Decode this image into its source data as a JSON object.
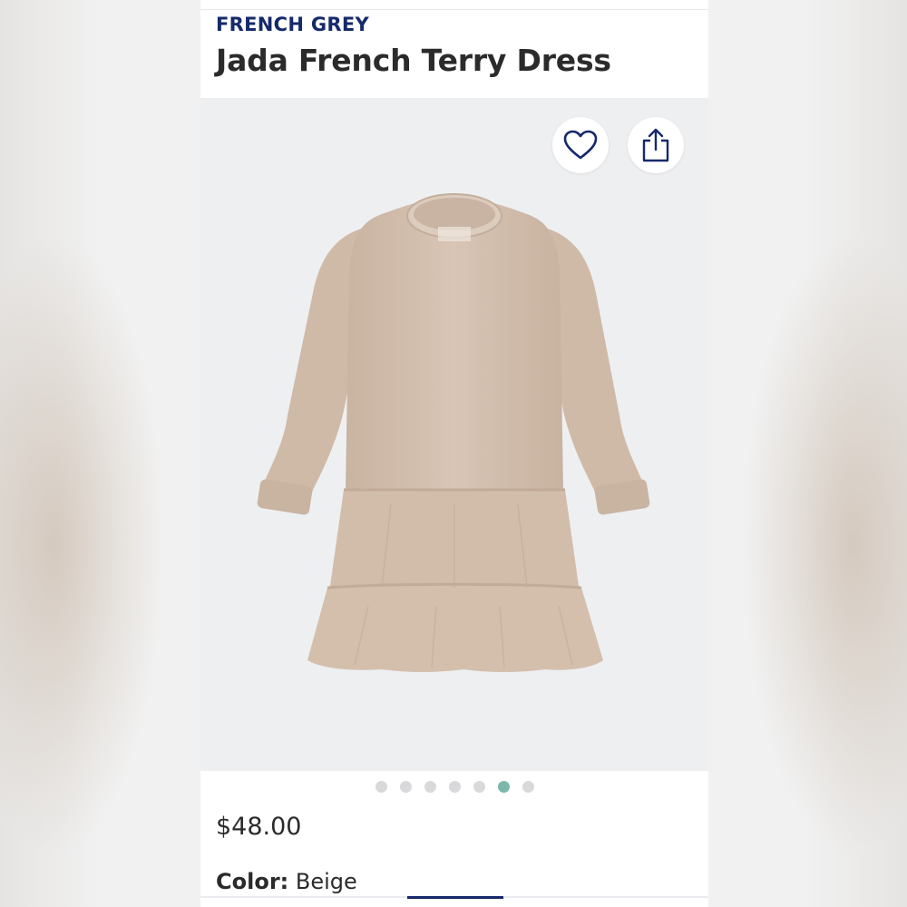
{
  "header": {
    "brand": "FRENCH GREY",
    "product_title": "Jada French Terry Dress"
  },
  "gallery": {
    "image_alt": "Beige tiered long-sleeve french terry dress",
    "dot_count": 7,
    "active_index": 5,
    "favorite_icon": "heart-icon",
    "share_icon": "share-icon"
  },
  "details": {
    "price": "$48.00",
    "color_label": "Color:",
    "color_value": "Beige"
  },
  "colors": {
    "brand": "#16296b",
    "active_dot": "#7cb8a9",
    "dress": "#d6c2b1"
  }
}
